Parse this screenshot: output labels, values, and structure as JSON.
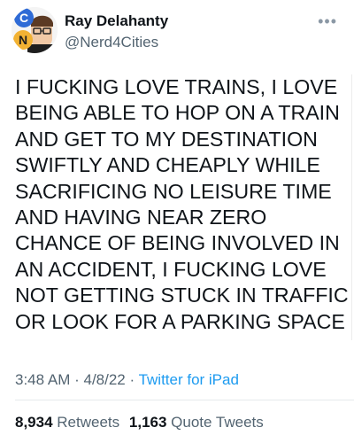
{
  "user": {
    "display_name": "Ray Delahanty",
    "handle": "@Nerd4Cities",
    "avatar_letters": [
      "C",
      "N"
    ],
    "avatar_colors": {
      "blue": "#2f6bd6",
      "orange": "#f2b233"
    }
  },
  "more_label": "•••",
  "tweet": {
    "text": "I FUCKING LOVE TRAINS, I LOVE\nBEING ABLE TO HOP ON A TRAIN\nAND GET TO MY DESTINATION\nSWIFTLY AND CHEAPLY WHILE\nSACRIFICING NO LEISURE TIME\nAND HAVING NEAR ZERO\nCHANCE OF BEING INVOLVED IN\nAN ACCIDENT, I FUCKING LOVE\nNOT GETTING STUCK IN TRAFFIC\nOR LOOK FOR A PARKING SPACE"
  },
  "meta": {
    "time": "3:48 AM",
    "sep1": " · ",
    "date": "4/8/22",
    "sep2": " · ",
    "source": "Twitter for iPad"
  },
  "stats": {
    "retweets_count": "8,934",
    "retweets_label": "Retweets",
    "quotes_count": "1,163",
    "quotes_label": "Quote Tweets"
  },
  "colors": {
    "link": "#1d9bf0",
    "secondary_text": "#536471",
    "primary_text": "#0f1419"
  }
}
